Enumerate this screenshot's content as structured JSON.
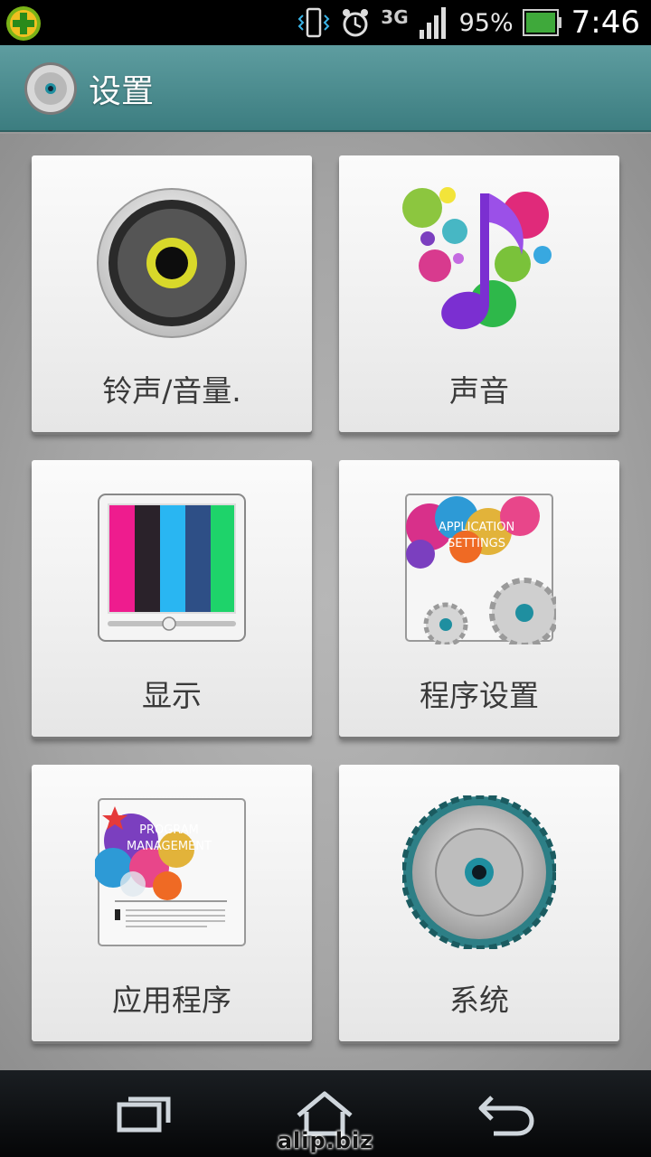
{
  "status_bar": {
    "network": "3G",
    "battery_percent": "95%",
    "time": "7:46"
  },
  "action_bar": {
    "title": "设置"
  },
  "tiles": [
    {
      "label": "铃声/音量.",
      "icon": "speaker-icon"
    },
    {
      "label": "声音",
      "icon": "music-note-icon"
    },
    {
      "label": "显示",
      "icon": "display-icon"
    },
    {
      "label": "程序设置",
      "icon": "application-settings-icon",
      "icon_text": [
        "APPLICATION",
        "SETTINGS"
      ]
    },
    {
      "label": "应用程序",
      "icon": "program-management-icon",
      "icon_text": [
        "PROGRAM",
        "MANAGEMENT"
      ]
    },
    {
      "label": "系统",
      "icon": "system-gear-icon"
    }
  ],
  "nav_bar": {
    "recent_icon": "recent-apps-icon",
    "home_icon": "home-icon",
    "back_icon": "back-icon"
  },
  "watermark": "alip.biz",
  "colors": {
    "action_bar": "#4a8b8e",
    "accent_teal": "#2a9aa6"
  }
}
